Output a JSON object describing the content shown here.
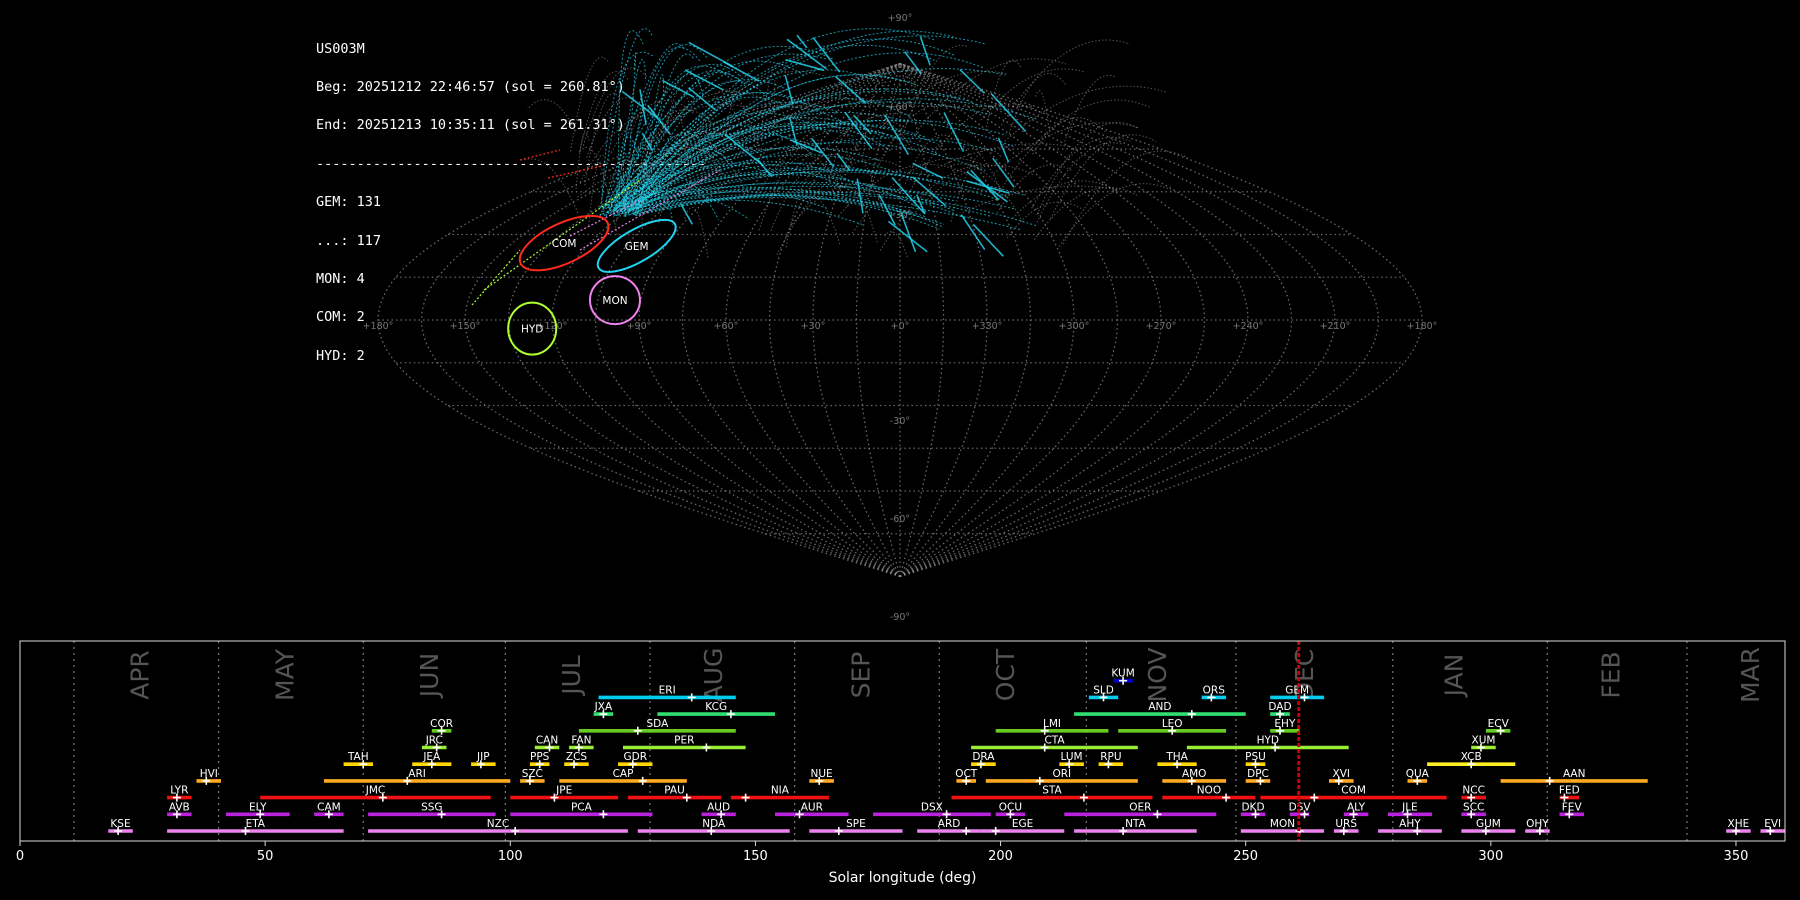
{
  "info": {
    "station": "US003M",
    "beg": "Beg: 20251212 22:46:57 (sol = 260.81°)",
    "end": "End: 20251213 10:35:11 (sol = 261.31°)",
    "separator": "------------------------------------------------",
    "counts": [
      "GEM: 131",
      "...: 117",
      "MON: 4",
      "COM: 2",
      "HYD: 2"
    ]
  },
  "colors": {
    "background": "#000000",
    "grid": "#8a8a8a",
    "GEM": "#22d3ee",
    "sporadic": "#9a9a9a",
    "COM": "#ff2a1a",
    "MON": "#ee82ee",
    "HYD": "#adff2f",
    "current_sol": "#cc0000"
  },
  "chart_data": [
    {
      "type": "scatter",
      "title": "",
      "projection": "sinusoidal all-sky map",
      "lon_ticks": [
        "+180°",
        "+150°",
        "+120°",
        "+90°",
        "+60°",
        "+30°",
        "+0°",
        "+330°",
        "+300°",
        "+270°",
        "+240°",
        "+210°",
        "+180°"
      ],
      "lat_ticks": [
        "+90°",
        "+60°",
        "+30°",
        "-30°",
        "-60°",
        "-90°"
      ],
      "radiants": [
        {
          "code": "COM",
          "lon": 130,
          "lat": 27,
          "color": "#ff2a1a",
          "count": 2
        },
        {
          "code": "GEM",
          "lon": 101,
          "lat": 26,
          "color": "#22d3ee",
          "count": 131
        },
        {
          "code": "MON",
          "lon": 99,
          "lat": 7,
          "color": "#ee82ee",
          "count": 4
        },
        {
          "code": "HYD",
          "lon": 127,
          "lat": -3,
          "color": "#adff2f",
          "count": 2
        }
      ],
      "grid": true
    },
    {
      "type": "bar",
      "title": "",
      "xlabel": "Solar longitude (deg)",
      "xlim": [
        0,
        360
      ],
      "x_ticks": [
        0,
        50,
        100,
        150,
        200,
        250,
        300,
        350
      ],
      "months": [
        {
          "label": "APR",
          "sol": 24.5
        },
        {
          "label": "MAY",
          "sol": 54
        },
        {
          "label": "JUN",
          "sol": 83.5
        },
        {
          "label": "JUL",
          "sol": 112.5
        },
        {
          "label": "AUG",
          "sol": 141.5
        },
        {
          "label": "SEP",
          "sol": 171.5
        },
        {
          "label": "OCT",
          "sol": 201
        },
        {
          "label": "NOV",
          "sol": 232
        },
        {
          "label": "DEC",
          "sol": 262
        },
        {
          "label": "JAN",
          "sol": 292.5
        },
        {
          "label": "FEB",
          "sol": 324.5
        },
        {
          "label": "MAR",
          "sol": 353
        }
      ],
      "month_boundaries": [
        11,
        40.5,
        70,
        99,
        128.5,
        158,
        187.5,
        217.5,
        248,
        280,
        311.5,
        340
      ],
      "current_sol": 260.81,
      "showers": [
        {
          "code": "KUM",
          "start": 223,
          "end": 227,
          "peak": 225,
          "row": 10,
          "color": "#0000cd"
        },
        {
          "code": "ERI",
          "start": 118,
          "end": 146,
          "peak": 137,
          "row": 9,
          "color": "#00ccee"
        },
        {
          "code": "SLD",
          "start": 218,
          "end": 224,
          "peak": 221,
          "row": 9,
          "color": "#00ccee"
        },
        {
          "code": "ORS",
          "start": 241,
          "end": 246,
          "peak": 243,
          "row": 9,
          "color": "#00ccee"
        },
        {
          "code": "GEM",
          "start": 255,
          "end": 266,
          "peak": 262,
          "row": 9,
          "color": "#00ccee"
        },
        {
          "code": "JXA",
          "start": 117,
          "end": 121,
          "peak": 119,
          "row": 8,
          "color": "#2fe06f"
        },
        {
          "code": "KCG",
          "start": 130,
          "end": 154,
          "peak": 145,
          "row": 8,
          "color": "#2fe06f"
        },
        {
          "code": "AND",
          "start": 215,
          "end": 250,
          "peak": 239,
          "row": 8,
          "color": "#2fe06f"
        },
        {
          "code": "DAD",
          "start": 255,
          "end": 259,
          "peak": 257,
          "row": 8,
          "color": "#2fe06f"
        },
        {
          "code": "COR",
          "start": 84,
          "end": 88,
          "peak": 86,
          "row": 7,
          "color": "#66cc22"
        },
        {
          "code": "SDA",
          "start": 114,
          "end": 146,
          "peak": 126,
          "row": 7,
          "color": "#66cc22"
        },
        {
          "code": "LMI",
          "start": 199,
          "end": 222,
          "peak": 209,
          "row": 7,
          "color": "#66cc22"
        },
        {
          "code": "LEO",
          "start": 224,
          "end": 246,
          "peak": 235,
          "row": 7,
          "color": "#66cc22"
        },
        {
          "code": "EHY",
          "start": 255,
          "end": 261,
          "peak": 257,
          "row": 7,
          "color": "#66cc22"
        },
        {
          "code": "ECV",
          "start": 299,
          "end": 304,
          "peak": 302,
          "row": 7,
          "color": "#66cc22"
        },
        {
          "code": "JRC",
          "start": 82,
          "end": 87,
          "peak": 85,
          "row": 6,
          "color": "#99ee33"
        },
        {
          "code": "CAN",
          "start": 105,
          "end": 110,
          "peak": 108,
          "row": 6,
          "color": "#99ee33"
        },
        {
          "code": "FAN",
          "start": 112,
          "end": 117,
          "peak": 114,
          "row": 6,
          "color": "#99ee33"
        },
        {
          "code": "PER",
          "start": 123,
          "end": 148,
          "peak": 140,
          "row": 6,
          "color": "#99ee33"
        },
        {
          "code": "CTA",
          "start": 194,
          "end": 228,
          "peak": 209,
          "row": 6,
          "color": "#99ee33"
        },
        {
          "code": "HYD",
          "start": 238,
          "end": 271,
          "peak": 256,
          "row": 6,
          "color": "#99ee33"
        },
        {
          "code": "XUM",
          "start": 296,
          "end": 301,
          "peak": 298,
          "row": 6,
          "color": "#99ee33"
        },
        {
          "code": "TAH",
          "start": 66,
          "end": 72,
          "peak": 70,
          "row": 5,
          "color": "#ffd700"
        },
        {
          "code": "JEA",
          "start": 80,
          "end": 88,
          "peak": 84,
          "row": 5,
          "color": "#ffd700"
        },
        {
          "code": "JIP",
          "start": 92,
          "end": 97,
          "peak": 94,
          "row": 5,
          "color": "#ffd700"
        },
        {
          "code": "PPS",
          "start": 104,
          "end": 108,
          "peak": 106,
          "row": 5,
          "color": "#ffd700"
        },
        {
          "code": "ZCS",
          "start": 111,
          "end": 116,
          "peak": 113,
          "row": 5,
          "color": "#ffd700"
        },
        {
          "code": "GDR",
          "start": 122,
          "end": 129,
          "peak": 125,
          "row": 5,
          "color": "#ffd700"
        },
        {
          "code": "DRA",
          "start": 194,
          "end": 199,
          "peak": 196,
          "row": 5,
          "color": "#ffd700"
        },
        {
          "code": "LUM",
          "start": 212,
          "end": 217,
          "peak": 214,
          "row": 5,
          "color": "#ffd700"
        },
        {
          "code": "RPU",
          "start": 220,
          "end": 225,
          "peak": 222,
          "row": 5,
          "color": "#ffd700"
        },
        {
          "code": "THA",
          "start": 232,
          "end": 240,
          "peak": 236,
          "row": 5,
          "color": "#ffd700"
        },
        {
          "code": "PSU",
          "start": 250,
          "end": 254,
          "peak": 252,
          "row": 5,
          "color": "#ffd700"
        },
        {
          "code": "XCB",
          "start": 287,
          "end": 305,
          "peak": 296,
          "row": 5,
          "color": "#ffee22"
        },
        {
          "code": "HVI",
          "start": 36,
          "end": 41,
          "peak": 38,
          "row": 4,
          "color": "#ffaa22"
        },
        {
          "code": "ARI",
          "start": 62,
          "end": 100,
          "peak": 79,
          "row": 4,
          "color": "#ffaa22"
        },
        {
          "code": "SZC",
          "start": 102,
          "end": 107,
          "peak": 104,
          "row": 4,
          "color": "#ffaa22"
        },
        {
          "code": "CAP",
          "start": 110,
          "end": 136,
          "peak": 127,
          "row": 4,
          "color": "#ffaa22"
        },
        {
          "code": "NUE",
          "start": 161,
          "end": 166,
          "peak": 163,
          "row": 4,
          "color": "#ffaa22"
        },
        {
          "code": "OCT",
          "start": 191,
          "end": 195,
          "peak": 193,
          "row": 4,
          "color": "#ffaa22"
        },
        {
          "code": "ORI",
          "start": 197,
          "end": 228,
          "peak": 208,
          "row": 4,
          "color": "#ffaa22"
        },
        {
          "code": "AMO",
          "start": 233,
          "end": 246,
          "peak": 239,
          "row": 4,
          "color": "#ffaa22"
        },
        {
          "code": "DPC",
          "start": 250,
          "end": 255,
          "peak": 253,
          "row": 4,
          "color": "#ffaa22"
        },
        {
          "code": "XVI",
          "start": 267,
          "end": 272,
          "peak": 269,
          "row": 4,
          "color": "#ffaa22"
        },
        {
          "code": "QUA",
          "start": 283,
          "end": 287,
          "peak": 285,
          "row": 4,
          "color": "#ffaa22"
        },
        {
          "code": "AAN",
          "start": 302,
          "end": 332,
          "peak": 312,
          "row": 4,
          "color": "#ffaa22"
        },
        {
          "code": "LYR",
          "start": 30,
          "end": 35,
          "peak": 32,
          "row": 3,
          "color": "#ee1111"
        },
        {
          "code": "JMC",
          "start": 49,
          "end": 96,
          "peak": 74,
          "row": 3,
          "color": "#ee1111"
        },
        {
          "code": "JPE",
          "start": 100,
          "end": 122,
          "peak": 109,
          "row": 3,
          "color": "#ee1111"
        },
        {
          "code": "PAU",
          "start": 124,
          "end": 143,
          "peak": 136,
          "row": 3,
          "color": "#ee1111"
        },
        {
          "code": "NIA",
          "start": 145,
          "end": 165,
          "peak": 148,
          "row": 3,
          "color": "#ee1111"
        },
        {
          "code": "STA",
          "start": 190,
          "end": 231,
          "peak": 217,
          "row": 3,
          "color": "#ee1111"
        },
        {
          "code": "NOO",
          "start": 233,
          "end": 252,
          "peak": 246,
          "row": 3,
          "color": "#ee1111"
        },
        {
          "code": "COM",
          "start": 253,
          "end": 291,
          "peak": 264,
          "row": 3,
          "color": "#ee1111"
        },
        {
          "code": "NCC",
          "start": 294,
          "end": 299,
          "peak": 296,
          "row": 3,
          "color": "#ee1111"
        },
        {
          "code": "FED",
          "start": 314,
          "end": 318,
          "peak": 315,
          "row": 3,
          "color": "#ee1111"
        },
        {
          "code": "AVB",
          "start": 30,
          "end": 35,
          "peak": 32,
          "row": 2,
          "color": "#bb22dd"
        },
        {
          "code": "ELY",
          "start": 42,
          "end": 55,
          "peak": 49,
          "row": 2,
          "color": "#bb22dd"
        },
        {
          "code": "CAM",
          "start": 60,
          "end": 66,
          "peak": 63,
          "row": 2,
          "color": "#bb22dd"
        },
        {
          "code": "SSG",
          "start": 71,
          "end": 97,
          "peak": 86,
          "row": 2,
          "color": "#bb22dd"
        },
        {
          "code": "PCA",
          "start": 100,
          "end": 129,
          "peak": 119,
          "row": 2,
          "color": "#bb22dd"
        },
        {
          "code": "AUD",
          "start": 139,
          "end": 146,
          "peak": 143,
          "row": 2,
          "color": "#bb22dd"
        },
        {
          "code": "AUR",
          "start": 154,
          "end": 169,
          "peak": 159,
          "row": 2,
          "color": "#bb22dd"
        },
        {
          "code": "DSX",
          "start": 174,
          "end": 198,
          "peak": 189,
          "row": 2,
          "color": "#bb22dd"
        },
        {
          "code": "OCU",
          "start": 199,
          "end": 205,
          "peak": 202,
          "row": 2,
          "color": "#bb22dd"
        },
        {
          "code": "OER",
          "start": 213,
          "end": 244,
          "peak": 232,
          "row": 2,
          "color": "#bb22dd"
        },
        {
          "code": "DKD",
          "start": 249,
          "end": 254,
          "peak": 252,
          "row": 2,
          "color": "#bb22dd"
        },
        {
          "code": "DSV",
          "start": 259,
          "end": 263,
          "peak": 262,
          "row": 2,
          "color": "#bb22dd"
        },
        {
          "code": "ALY",
          "start": 270,
          "end": 275,
          "peak": 272,
          "row": 2,
          "color": "#bb22dd"
        },
        {
          "code": "JLE",
          "start": 279,
          "end": 288,
          "peak": 283,
          "row": 2,
          "color": "#bb22dd"
        },
        {
          "code": "SCC",
          "start": 294,
          "end": 299,
          "peak": 296,
          "row": 2,
          "color": "#bb22dd"
        },
        {
          "code": "FEV",
          "start": 314,
          "end": 319,
          "peak": 316,
          "row": 2,
          "color": "#bb22dd"
        },
        {
          "code": "KSE",
          "start": 18,
          "end": 23,
          "peak": 20,
          "row": 1,
          "color": "#ee82ee"
        },
        {
          "code": "ETA",
          "start": 30,
          "end": 66,
          "peak": 46,
          "row": 1,
          "color": "#ee82ee"
        },
        {
          "code": "NZC",
          "start": 71,
          "end": 124,
          "peak": 101,
          "row": 1,
          "color": "#ee82ee"
        },
        {
          "code": "NDA",
          "start": 126,
          "end": 157,
          "peak": 141,
          "row": 1,
          "color": "#ee82ee"
        },
        {
          "code": "SPE",
          "start": 161,
          "end": 180,
          "peak": 167,
          "row": 1,
          "color": "#ee82ee"
        },
        {
          "code": "ARD",
          "start": 183,
          "end": 196,
          "peak": 193,
          "row": 1,
          "color": "#ee82ee"
        },
        {
          "code": "EGE",
          "start": 196,
          "end": 213,
          "peak": 199,
          "row": 1,
          "color": "#ee82ee"
        },
        {
          "code": "NTA",
          "start": 215,
          "end": 240,
          "peak": 225,
          "row": 1,
          "color": "#ee82ee"
        },
        {
          "code": "MON",
          "start": 249,
          "end": 266,
          "peak": 261,
          "row": 1,
          "color": "#ee82ee"
        },
        {
          "code": "URS",
          "start": 268,
          "end": 273,
          "peak": 270,
          "row": 1,
          "color": "#ee82ee"
        },
        {
          "code": "AHY",
          "start": 277,
          "end": 290,
          "peak": 285,
          "row": 1,
          "color": "#ee82ee"
        },
        {
          "code": "GUM",
          "start": 294,
          "end": 305,
          "peak": 299,
          "row": 1,
          "color": "#ee82ee"
        },
        {
          "code": "OHY",
          "start": 307,
          "end": 312,
          "peak": 310,
          "row": 1,
          "color": "#ee82ee"
        },
        {
          "code": "XHE",
          "start": 348,
          "end": 353,
          "peak": 350,
          "row": 1,
          "color": "#ee82ee"
        },
        {
          "code": "EVI",
          "start": 355,
          "end": 360,
          "peak": 357,
          "row": 1,
          "color": "#ee82ee"
        }
      ]
    }
  ]
}
